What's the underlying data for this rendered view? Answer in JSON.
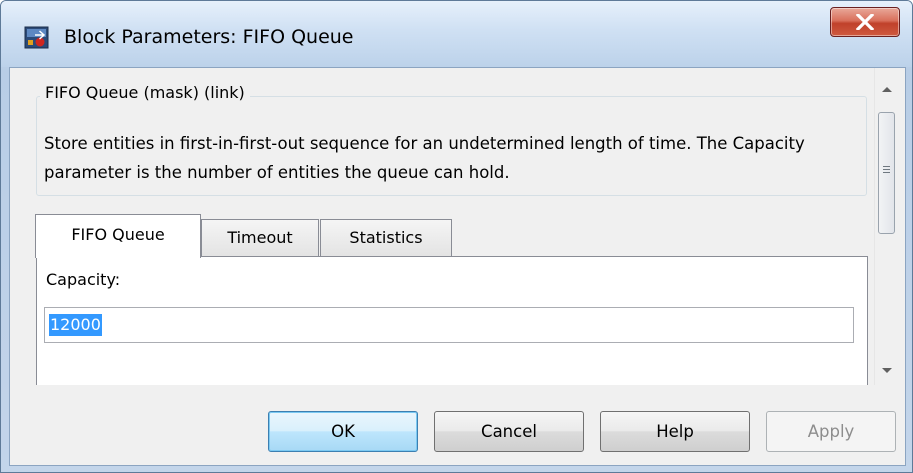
{
  "window": {
    "title": "Block Parameters: FIFO Queue",
    "close_glyph": "X"
  },
  "group": {
    "legend": "FIFO Queue (mask) (link)",
    "description": "Store entities in first-in-first-out sequence for an undetermined length of time. The Capacity parameter is the number of entities the queue can hold."
  },
  "tabs": [
    {
      "label": "FIFO Queue",
      "active": true
    },
    {
      "label": "Timeout",
      "active": false
    },
    {
      "label": "Statistics",
      "active": false
    }
  ],
  "panel": {
    "capacity_label": "Capacity:",
    "capacity_value": "12000"
  },
  "buttons": {
    "ok": "OK",
    "cancel": "Cancel",
    "help": "Help",
    "apply": "Apply"
  },
  "icons": {
    "app": "simulink-block-icon",
    "close": "close-icon",
    "scroll_up": "chevron-up-icon",
    "scroll_down": "chevron-down-icon"
  },
  "colors": {
    "close_button": "#c0412b",
    "selection": "#3399ff",
    "default_button_border": "#3c7fb1"
  }
}
